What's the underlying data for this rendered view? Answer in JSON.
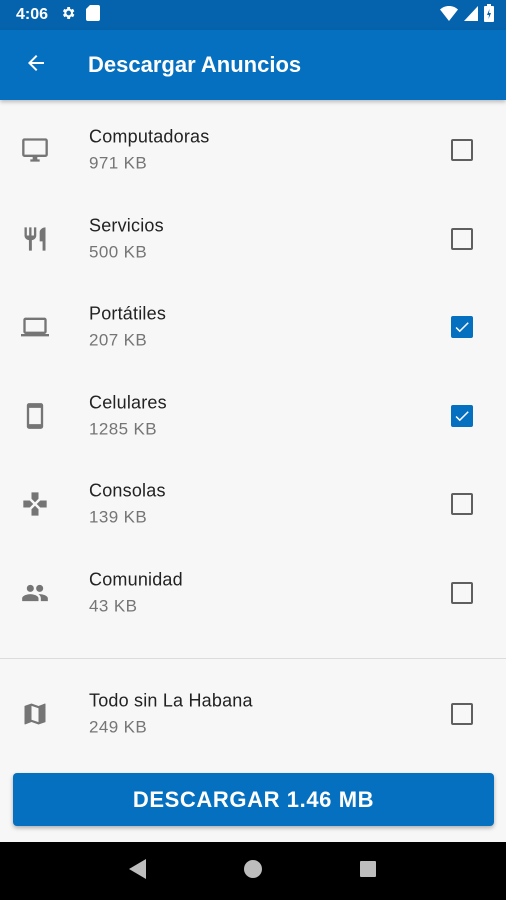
{
  "status_bar": {
    "time": "4:06"
  },
  "app_bar": {
    "title": "Descargar Anuncios"
  },
  "categories": [
    {
      "name": "Computadoras",
      "size": "971 KB",
      "checked": false,
      "icon": "desktop-monitor-icon"
    },
    {
      "name": "Servicios",
      "size": "500 KB",
      "checked": false,
      "icon": "restaurant-icon"
    },
    {
      "name": "Portátiles",
      "size": "207 KB",
      "checked": true,
      "icon": "laptop-icon"
    },
    {
      "name": "Celulares",
      "size": "1285 KB",
      "checked": true,
      "icon": "smartphone-icon"
    },
    {
      "name": "Consolas",
      "size": "139 KB",
      "checked": false,
      "icon": "gamepad-icon"
    },
    {
      "name": "Comunidad",
      "size": "43 KB",
      "checked": false,
      "icon": "people-icon"
    }
  ],
  "region": {
    "name": "Todo sin La Habana",
    "size": "249 KB",
    "checked": false,
    "icon": "map-icon"
  },
  "download_button": {
    "label": "DESCARGAR 1.46 MB"
  },
  "colors": {
    "primary": "#0570c0",
    "status_bar": "#0563ad",
    "background": "#f7f7f7",
    "icon_gray": "#757575"
  }
}
